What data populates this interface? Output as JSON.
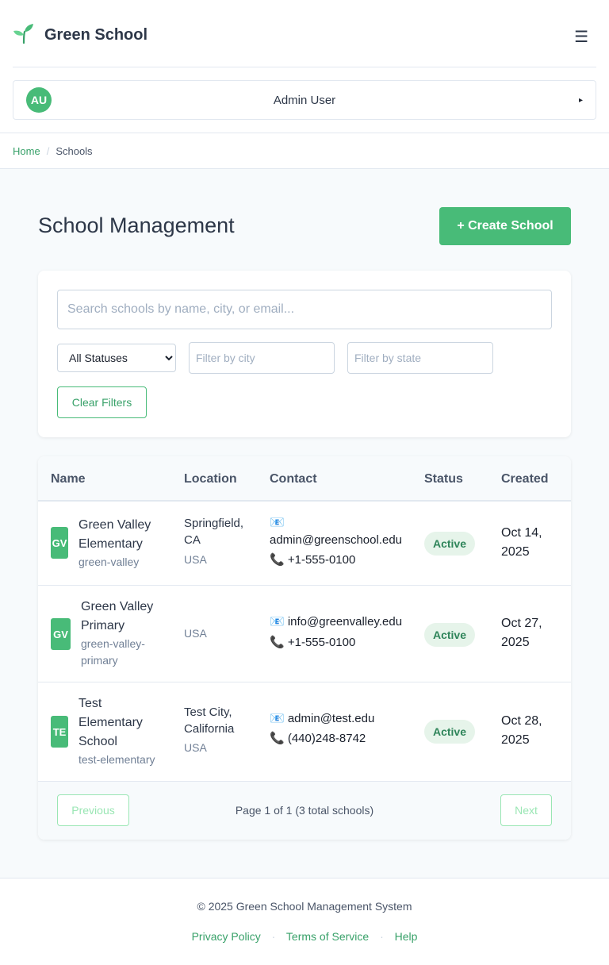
{
  "header": {
    "title": "Green School",
    "menu_icon": "☰",
    "user": {
      "initials": "AU",
      "name": "Admin User",
      "caret": "▸"
    }
  },
  "breadcrumb": {
    "home": "Home",
    "separator": "/",
    "current": "Schools"
  },
  "main": {
    "title": "School Management",
    "create_button": "+ Create School"
  },
  "filters": {
    "search_placeholder": "Search schools by name, city, or email...",
    "status_selected": "All Statuses",
    "city_placeholder": "Filter by city",
    "state_placeholder": "Filter by state",
    "clear_button": "Clear Filters"
  },
  "table": {
    "columns": [
      "Name",
      "Location",
      "Contact",
      "Status",
      "Created"
    ],
    "rows": [
      {
        "initials": "GV",
        "name_lines": [
          "Green Valley",
          "Elementary"
        ],
        "slug_lines": [
          "green-valley"
        ],
        "city_lines": [
          "Springfield,",
          "CA"
        ],
        "country": "USA",
        "email_lines": [
          "📧",
          "admin@greenschool.edu"
        ],
        "phone": "📞 +1-555-0100",
        "status": "Active",
        "created_lines": [
          "Oct 14,",
          "2025"
        ]
      },
      {
        "initials": "GV",
        "name_lines": [
          "Green Valley",
          "Primary"
        ],
        "slug_lines": [
          "green-valley-",
          "primary"
        ],
        "city_lines": [],
        "country": "USA",
        "email_lines": [
          "📧 info@greenvalley.edu"
        ],
        "phone": "📞 +1-555-0100",
        "status": "Active",
        "created_lines": [
          "Oct 27,",
          "2025"
        ]
      },
      {
        "initials": "TE",
        "name_lines": [
          "Test",
          "Elementary",
          "School"
        ],
        "slug_lines": [
          "test-elementary"
        ],
        "city_lines": [
          "Test City,",
          "California"
        ],
        "country": "USA",
        "email_lines": [
          "📧 admin@test.edu"
        ],
        "phone": "📞 (440)248-8742",
        "status": "Active",
        "created_lines": [
          "Oct 28,",
          "2025"
        ]
      }
    ]
  },
  "pagination": {
    "previous": "Previous",
    "next": "Next",
    "info": "Page 1 of 1 (3 total schools)"
  },
  "footer": {
    "copyright": "© 2025 Green School Management System",
    "links": [
      "Privacy Policy",
      "Terms of Service",
      "Help"
    ],
    "separator": "·"
  },
  "colors": {
    "brand": "#48bb78",
    "link": "#38a169",
    "badge_bg": "#e6f4ea",
    "badge_text": "#2f855a"
  }
}
